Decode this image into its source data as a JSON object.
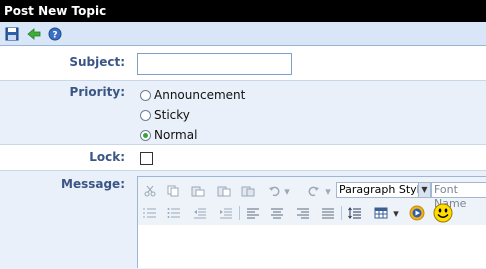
{
  "window": {
    "title": "Post New Topic"
  },
  "toolbar": {
    "save_icon": "save-icon",
    "back_icon": "back-arrow-icon",
    "help_icon": "help-icon"
  },
  "form": {
    "subject_label": "Subject:",
    "subject_value": "",
    "priority_label": "Priority:",
    "priority_options": [
      "Announcement",
      "Sticky",
      "Normal"
    ],
    "priority_selected": "Normal",
    "lock_label": "Lock:",
    "lock_checked": false,
    "message_label": "Message:"
  },
  "editor": {
    "paragraph_style": "Paragraph Style",
    "font_name": "Font Name"
  },
  "colors": {
    "titlebar": "#000000",
    "label": "#3b5585",
    "toolbar_bg": "#d8e6f7",
    "row_alt": "#e9f0f9"
  }
}
